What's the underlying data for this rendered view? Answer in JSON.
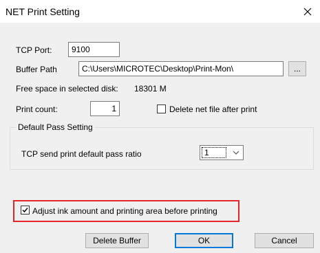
{
  "window": {
    "title": "NET Print Setting"
  },
  "tcp": {
    "label": "TCP Port:",
    "value": "9100"
  },
  "buffer": {
    "label": "Buffer Path",
    "value": "C:\\Users\\MICROTEC\\Desktop\\Print-Mon\\",
    "browse_label": "..."
  },
  "disk": {
    "label": "Free space in selected disk:",
    "value": "18301 M"
  },
  "print_count": {
    "label": "Print count:",
    "value": "1"
  },
  "delete_net_file": {
    "label": "Delete net file after print",
    "checked": false
  },
  "default_pass": {
    "group_label": "Default Pass Setting",
    "ratio_label": "TCP send print default pass ratio",
    "ratio_value": "1"
  },
  "adjust_ink": {
    "label": "Adjust ink amount and printing area before printing",
    "checked": true
  },
  "buttons": {
    "delete_buffer": "Delete Buffer",
    "ok": "OK",
    "cancel": "Cancel"
  },
  "colors": {
    "highlight": "#e3242b",
    "accent": "#0078d7"
  }
}
